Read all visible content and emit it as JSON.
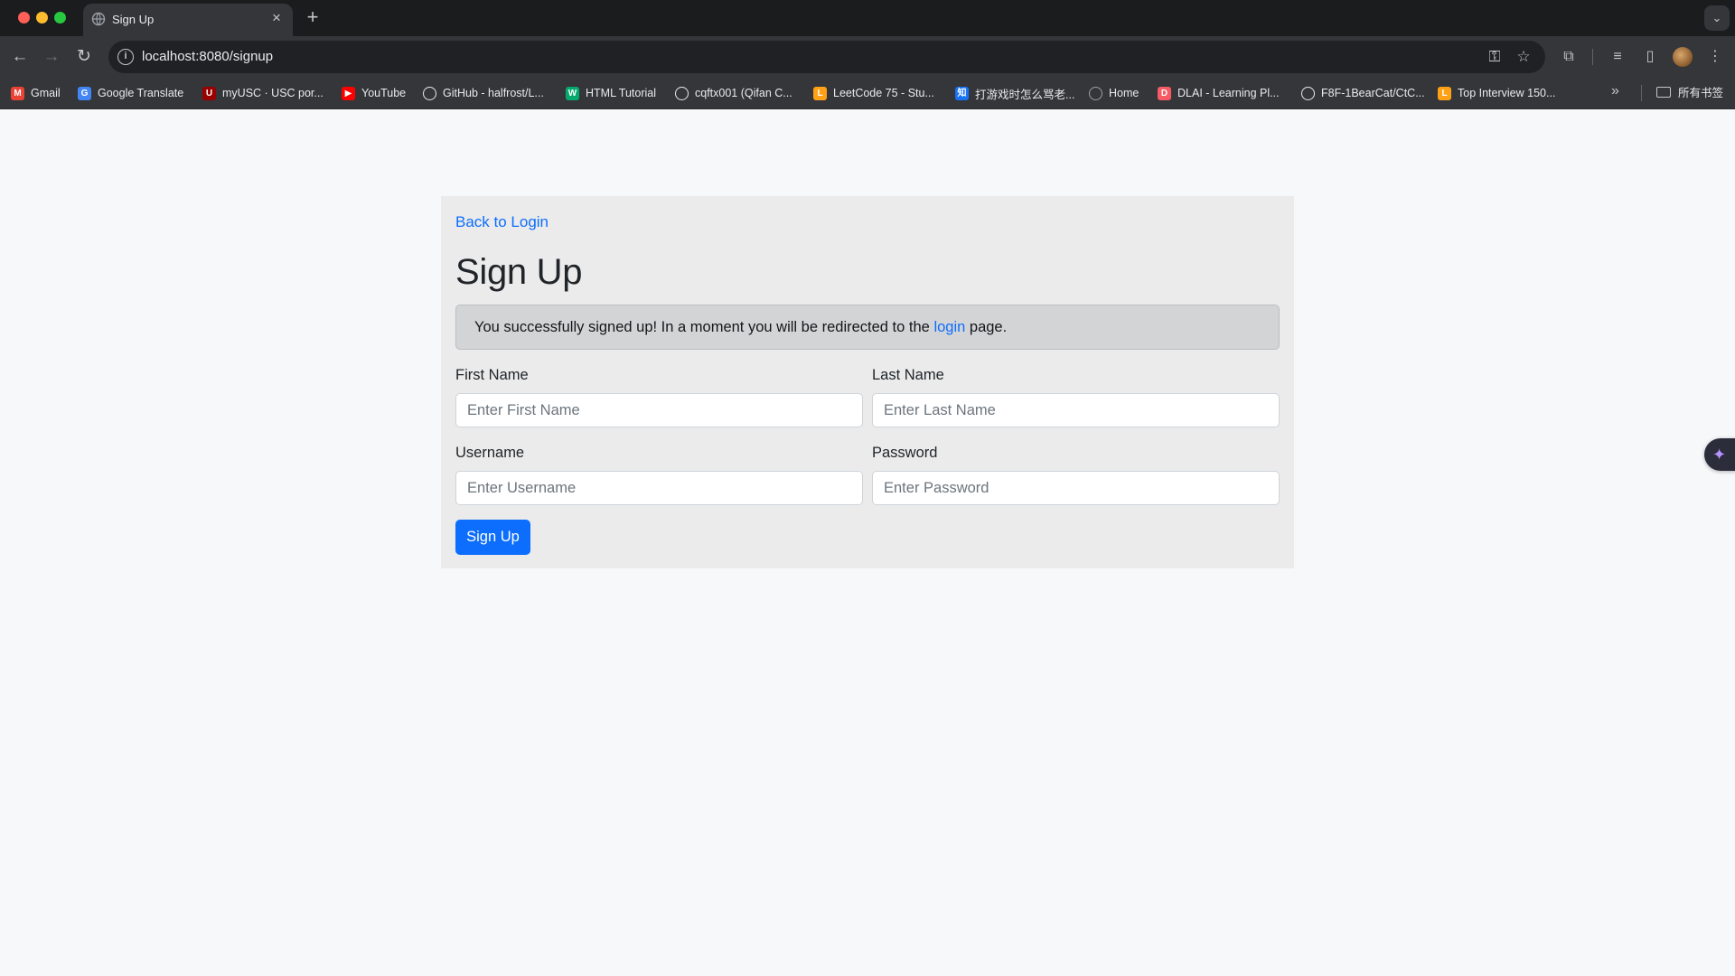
{
  "browser": {
    "tab_title": "Sign Up",
    "url_host": "localhost",
    "url_rest": ":8080/signup",
    "bookmarks": [
      {
        "label": "Gmail",
        "icon": "gmail-icon",
        "color": "#ea4335",
        "glyph": "M"
      },
      {
        "label": "Google Translate",
        "icon": "google-translate-icon",
        "color": "#4285f4",
        "glyph": "G"
      },
      {
        "label": "myUSC · USC por...",
        "icon": "usc-icon",
        "color": "#990000",
        "glyph": "U"
      },
      {
        "label": "YouTube",
        "icon": "youtube-icon",
        "color": "#ff0000",
        "glyph": "▶"
      },
      {
        "label": "GitHub - halfrost/L...",
        "icon": "github-icon",
        "color": "#e8eaed",
        "glyph": ""
      },
      {
        "label": "HTML Tutorial",
        "icon": "w3schools-icon",
        "color": "#04aa6d",
        "glyph": "W"
      },
      {
        "label": "cqftx001 (Qifan C...",
        "icon": "github-icon",
        "color": "#e8eaed",
        "glyph": ""
      },
      {
        "label": "LeetCode 75 - Stu...",
        "icon": "leetcode-icon",
        "color": "#ffa116",
        "glyph": "L"
      },
      {
        "label": "打游戏时怎么骂老...",
        "icon": "zhihu-icon",
        "color": "#1772f6",
        "glyph": "知"
      },
      {
        "label": "Home",
        "icon": "globe-icon",
        "color": "#9aa0a6",
        "glyph": ""
      },
      {
        "label": "DLAI - Learning Pl...",
        "icon": "dlai-icon",
        "color": "#f65b66",
        "glyph": "D"
      },
      {
        "label": "F8F-1BearCat/CtC...",
        "icon": "github-icon",
        "color": "#e8eaed",
        "glyph": ""
      },
      {
        "label": "Top Interview 150...",
        "icon": "leetcode-icon",
        "color": "#ffa116",
        "glyph": "L"
      }
    ],
    "bookmarks_folder": "所有书签"
  },
  "page": {
    "back_link": "Back to Login",
    "title": "Sign Up",
    "alert": {
      "before": "You successfully signed up! In a moment you will be redirected to the ",
      "link": "login",
      "after": " page."
    },
    "fields": {
      "first_name": {
        "label": "First Name",
        "placeholder": "Enter First Name"
      },
      "last_name": {
        "label": "Last Name",
        "placeholder": "Enter Last Name"
      },
      "username": {
        "label": "Username",
        "placeholder": "Enter Username"
      },
      "password": {
        "label": "Password",
        "placeholder": "Enter Password"
      }
    },
    "submit_label": "Sign Up"
  },
  "colors": {
    "primary": "#0d6efd",
    "card_bg": "#ebebeb",
    "alert_bg": "#d3d4d5",
    "page_bg": "#f7f8fa"
  }
}
